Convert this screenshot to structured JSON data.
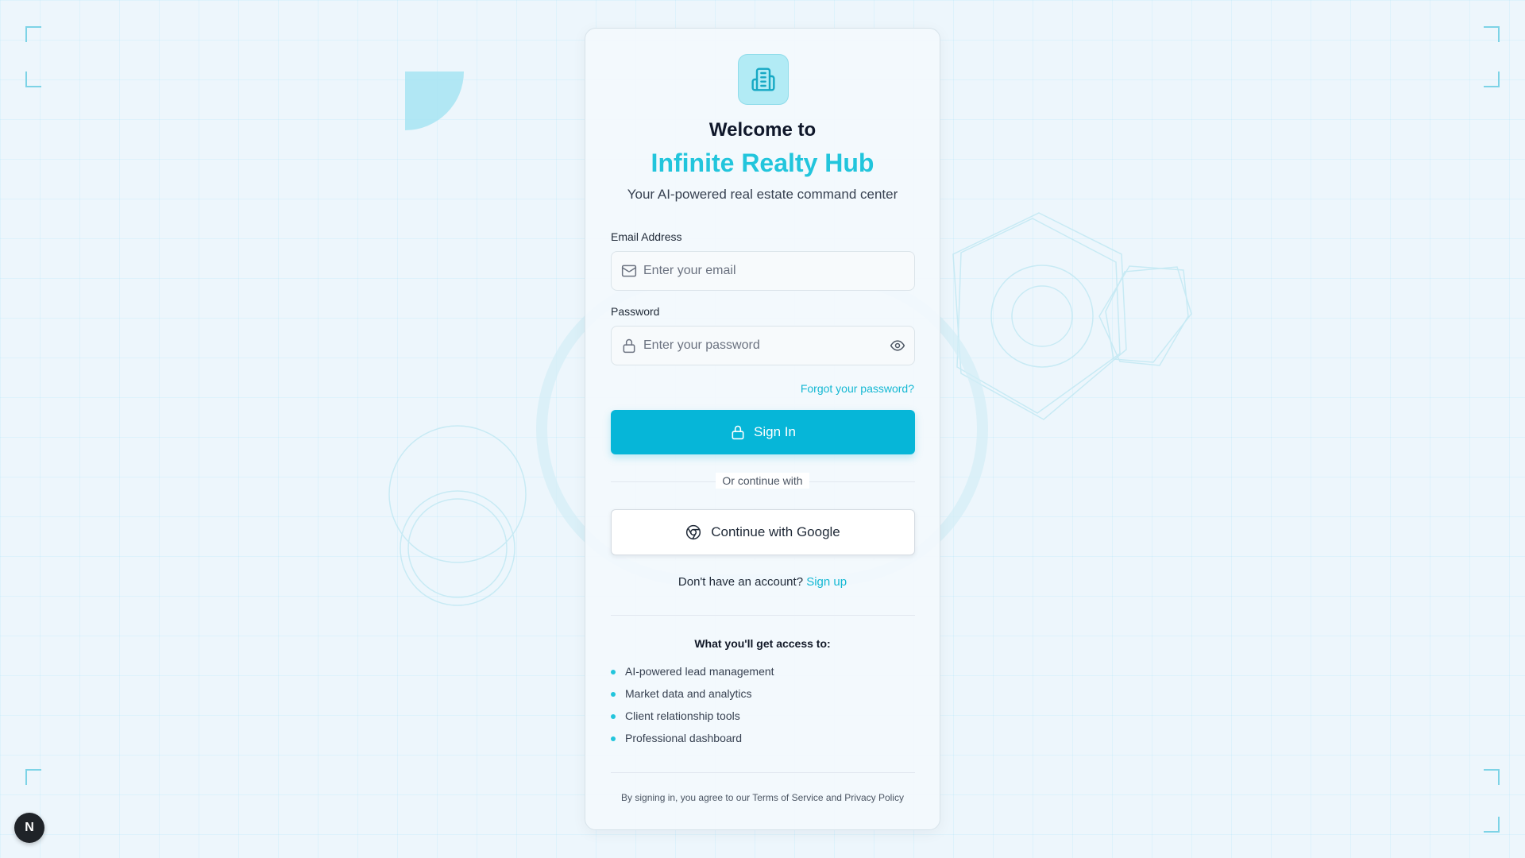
{
  "header": {
    "welcome": "Welcome to",
    "brand": "Infinite Realty Hub",
    "tagline": "Your AI-powered real estate command center"
  },
  "form": {
    "email_label": "Email Address",
    "email_placeholder": "Enter your email",
    "email_value": "",
    "password_label": "Password",
    "password_placeholder": "Enter your password",
    "password_value": "",
    "forgot": "Forgot your password?",
    "signin": "Sign In",
    "or_continue": "Or continue with",
    "google": "Continue with Google"
  },
  "signup": {
    "prompt": "Don't have an account?",
    "link": "Sign up"
  },
  "access": {
    "title": "What you'll get access to:",
    "items": [
      "AI-powered lead management",
      "Market data and analytics",
      "Client relationship tools",
      "Professional dashboard"
    ]
  },
  "legal": "By signing in, you agree to our Terms of Service and Privacy Policy",
  "badge": "N",
  "icons": {
    "logo": "building-icon",
    "email": "mail-icon",
    "password": "lock-icon",
    "toggle": "eye-icon",
    "signin": "lock-icon",
    "google": "chrome-icon"
  },
  "colors": {
    "accent": "#06b6d8",
    "brand_text": "#22c5dc",
    "background": "#edf6fc"
  }
}
